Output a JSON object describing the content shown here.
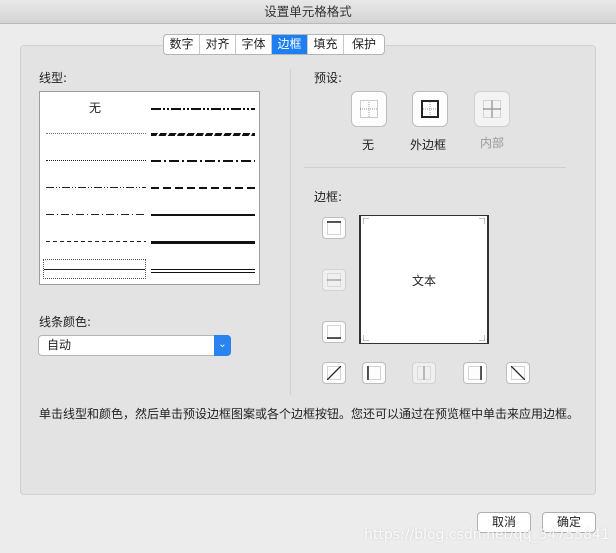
{
  "window": {
    "title": "设置单元格格式"
  },
  "tabs": [
    {
      "label": "数字"
    },
    {
      "label": "对齐"
    },
    {
      "label": "字体"
    },
    {
      "label": "边框"
    },
    {
      "label": "填充"
    },
    {
      "label": "保护"
    }
  ],
  "active_tab": "边框",
  "line_style": {
    "label": "线型:",
    "none_label": "无"
  },
  "line_color": {
    "label": "线条颜色:",
    "value": "自动",
    "arrow_icon": "chevron-updown-icon"
  },
  "presets": {
    "label": "预设:",
    "items": [
      {
        "label": "无",
        "enabled": true
      },
      {
        "label": "外边框",
        "enabled": true
      },
      {
        "label": "内部",
        "enabled": false
      }
    ]
  },
  "border": {
    "label": "边框:",
    "preview_text": "文本"
  },
  "description": "单击线型和颜色，然后单击预设边框图案或各个边框按钮。您还可以通过在预览框中单击来应用边框。",
  "buttons": {
    "cancel": "取消",
    "ok": "确定"
  },
  "watermark": "https://blog.csdn.net/qq_34755841",
  "colors": {
    "accent": "#1d7ff2",
    "panel": "#e3e3e3"
  }
}
